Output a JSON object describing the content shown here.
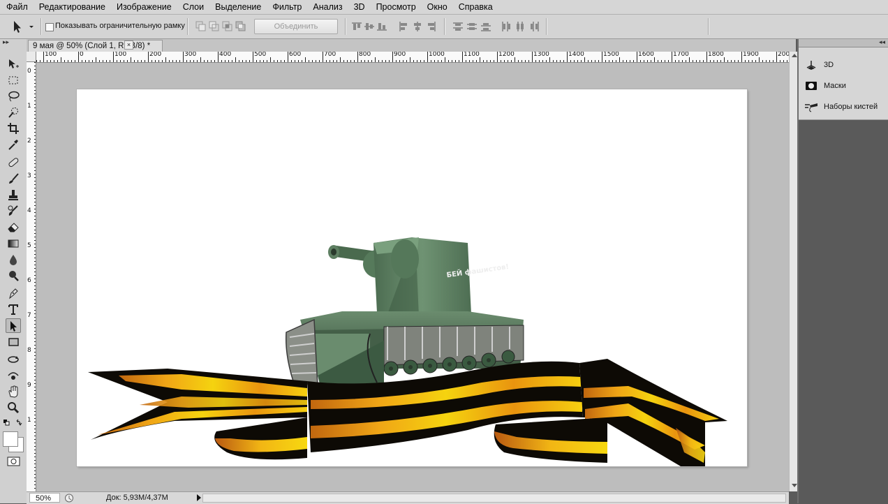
{
  "menu": [
    "Файл",
    "Редактирование",
    "Изображение",
    "Слои",
    "Выделение",
    "Фильтр",
    "Анализ",
    "3D",
    "Просмотр",
    "Окно",
    "Справка"
  ],
  "options": {
    "show_bounding_box_label": "Показывать ограничительную рамку",
    "combine_button": "Объединить"
  },
  "document": {
    "tab_title": "9 мая @ 50% (Слой 1, RGB/8) *",
    "close_glyph": "×",
    "canvas_text": "БЕЙ фашистов!"
  },
  "ruler": {
    "h_labels": [
      "100",
      "0",
      "100",
      "200",
      "300",
      "400",
      "500",
      "600",
      "700",
      "800",
      "900",
      "1000",
      "1100",
      "1200",
      "1300",
      "1400",
      "1500",
      "1600",
      "1700",
      "1800",
      "1900",
      "200"
    ],
    "v_labels": [
      "0",
      "1",
      "2",
      "3",
      "4",
      "5",
      "6",
      "7",
      "8",
      "9",
      "1"
    ]
  },
  "status": {
    "zoom": "50%",
    "doc_info": "Док: 5,93M/4,37M"
  },
  "panels": [
    {
      "label": "3D",
      "icon": "3d-icon"
    },
    {
      "label": "Маски",
      "icon": "masks-icon"
    },
    {
      "label": "Наборы кистей",
      "icon": "brush-presets-icon"
    }
  ],
  "colors": {
    "ribbon_black": "#0d0a05",
    "ribbon_orange": "#e89510",
    "ribbon_yellow": "#f3cc10",
    "tank_green": "#4a6a4e",
    "workspace": "#bdbdbd"
  }
}
